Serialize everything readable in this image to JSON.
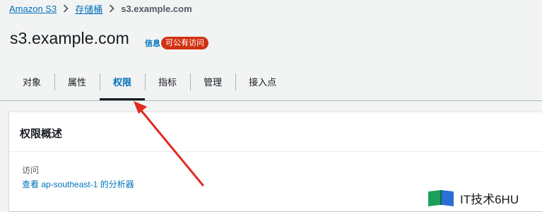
{
  "breadcrumb": {
    "items": [
      {
        "label": "Amazon S3",
        "link": true
      },
      {
        "label": "存储桶",
        "link": true
      },
      {
        "label": "s3.example.com",
        "link": false
      }
    ]
  },
  "header": {
    "title": "s3.example.com",
    "info_label": "信息",
    "badge_label": "可公有访问",
    "badge_color": "#d13212"
  },
  "tabs": [
    {
      "label": "对象",
      "active": false
    },
    {
      "label": "属性",
      "active": false
    },
    {
      "label": "权限",
      "active": true
    },
    {
      "label": "指标",
      "active": false
    },
    {
      "label": "管理",
      "active": false
    },
    {
      "label": "接入点",
      "active": false
    }
  ],
  "panel": {
    "title": "权限概述",
    "access_label": "访问",
    "analyzer_link": "查看 ap-southeast-1 的分析器"
  },
  "annotation": {
    "arrow_color": "#e02b20"
  },
  "watermark": {
    "text": "IT技术6HU"
  },
  "colors": {
    "link": "#0073bb",
    "background": "#f2f3f3"
  }
}
